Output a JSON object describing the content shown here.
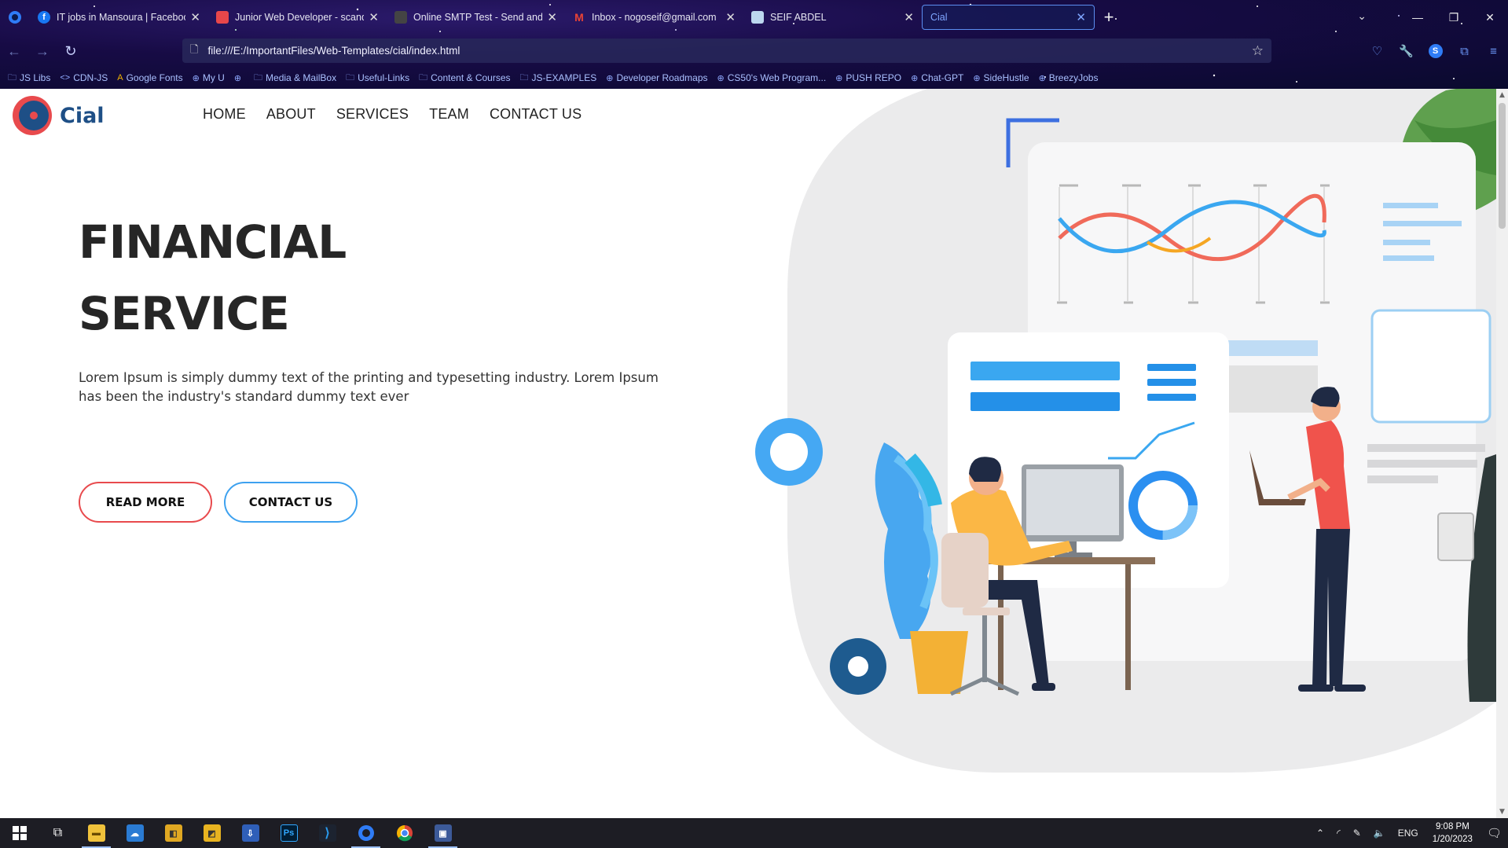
{
  "browser": {
    "tabs": [
      {
        "title": "IT jobs in Mansoura | Facebook",
        "favicon": "facebook-icon",
        "active": false
      },
      {
        "title": "Junior Web Developer - scandiweb",
        "favicon": "scandiweb-icon",
        "active": false
      },
      {
        "title": "Online SMTP Test - Send and Check",
        "favicon": "smtp-icon",
        "active": false
      },
      {
        "title": "Inbox - nogoseif@gmail.com",
        "favicon": "gmail-icon",
        "active": false
      },
      {
        "title": "SEIF ABDEL",
        "favicon": "profile-icon",
        "active": false
      },
      {
        "title": "Cial",
        "favicon": "",
        "active": true
      }
    ],
    "url": "file:///E:/ImportantFiles/Web-Templates/cial/index.html",
    "bookmarks": [
      {
        "label": "JS Libs",
        "icon": "folder-icon"
      },
      {
        "label": "CDN-JS",
        "icon": "code-icon"
      },
      {
        "label": "Google Fonts",
        "icon": "google-fonts-icon"
      },
      {
        "label": "My U",
        "icon": "globe-icon"
      },
      {
        "label": "",
        "icon": "globe-icon"
      },
      {
        "label": "Media & MailBox",
        "icon": "folder-icon"
      },
      {
        "label": "Useful-Links",
        "icon": "folder-icon"
      },
      {
        "label": "Content & Courses",
        "icon": "folder-icon"
      },
      {
        "label": "JS-EXAMPLES",
        "icon": "folder-icon"
      },
      {
        "label": "Developer Roadmaps",
        "icon": "globe-icon"
      },
      {
        "label": "CS50's Web Program...",
        "icon": "globe-icon"
      },
      {
        "label": "PUSH REPO",
        "icon": "globe-icon"
      },
      {
        "label": "Chat-GPT",
        "icon": "globe-icon"
      },
      {
        "label": "SideHustle",
        "icon": "globe-icon"
      },
      {
        "label": "BreezyJobs",
        "icon": "globe-icon"
      }
    ]
  },
  "site": {
    "logo_text": "Cial",
    "menu": [
      "HOME",
      "ABOUT",
      "SERVICES",
      "TEAM",
      "CONTACT US"
    ],
    "hero": {
      "title_line1": "FINANCIAL",
      "title_line2": "SERVICE",
      "text": "Lorem Ipsum is simply dummy text of the printing and typesetting industry. Lorem Ipsum has been the industry's standard dummy text ever",
      "read_more": "READ MORE",
      "contact_us": "CONTACT US"
    },
    "colors": {
      "accent_red": "#e84a4d",
      "accent_blue": "#3da1ef",
      "brand_navy": "#1e4f86"
    }
  },
  "taskbar": {
    "apps": [
      "windows-start-icon",
      "task-view-icon",
      "file-explorer-icon",
      "app-icon",
      "app-icon",
      "app-icon",
      "app-icon",
      "photoshop-icon",
      "vscode-icon",
      "firefox-icon",
      "chrome-icon",
      "app-icon"
    ],
    "photoshop_label": "Ps",
    "language": "ENG",
    "time": "9:08 PM",
    "date": "1/20/2023"
  }
}
